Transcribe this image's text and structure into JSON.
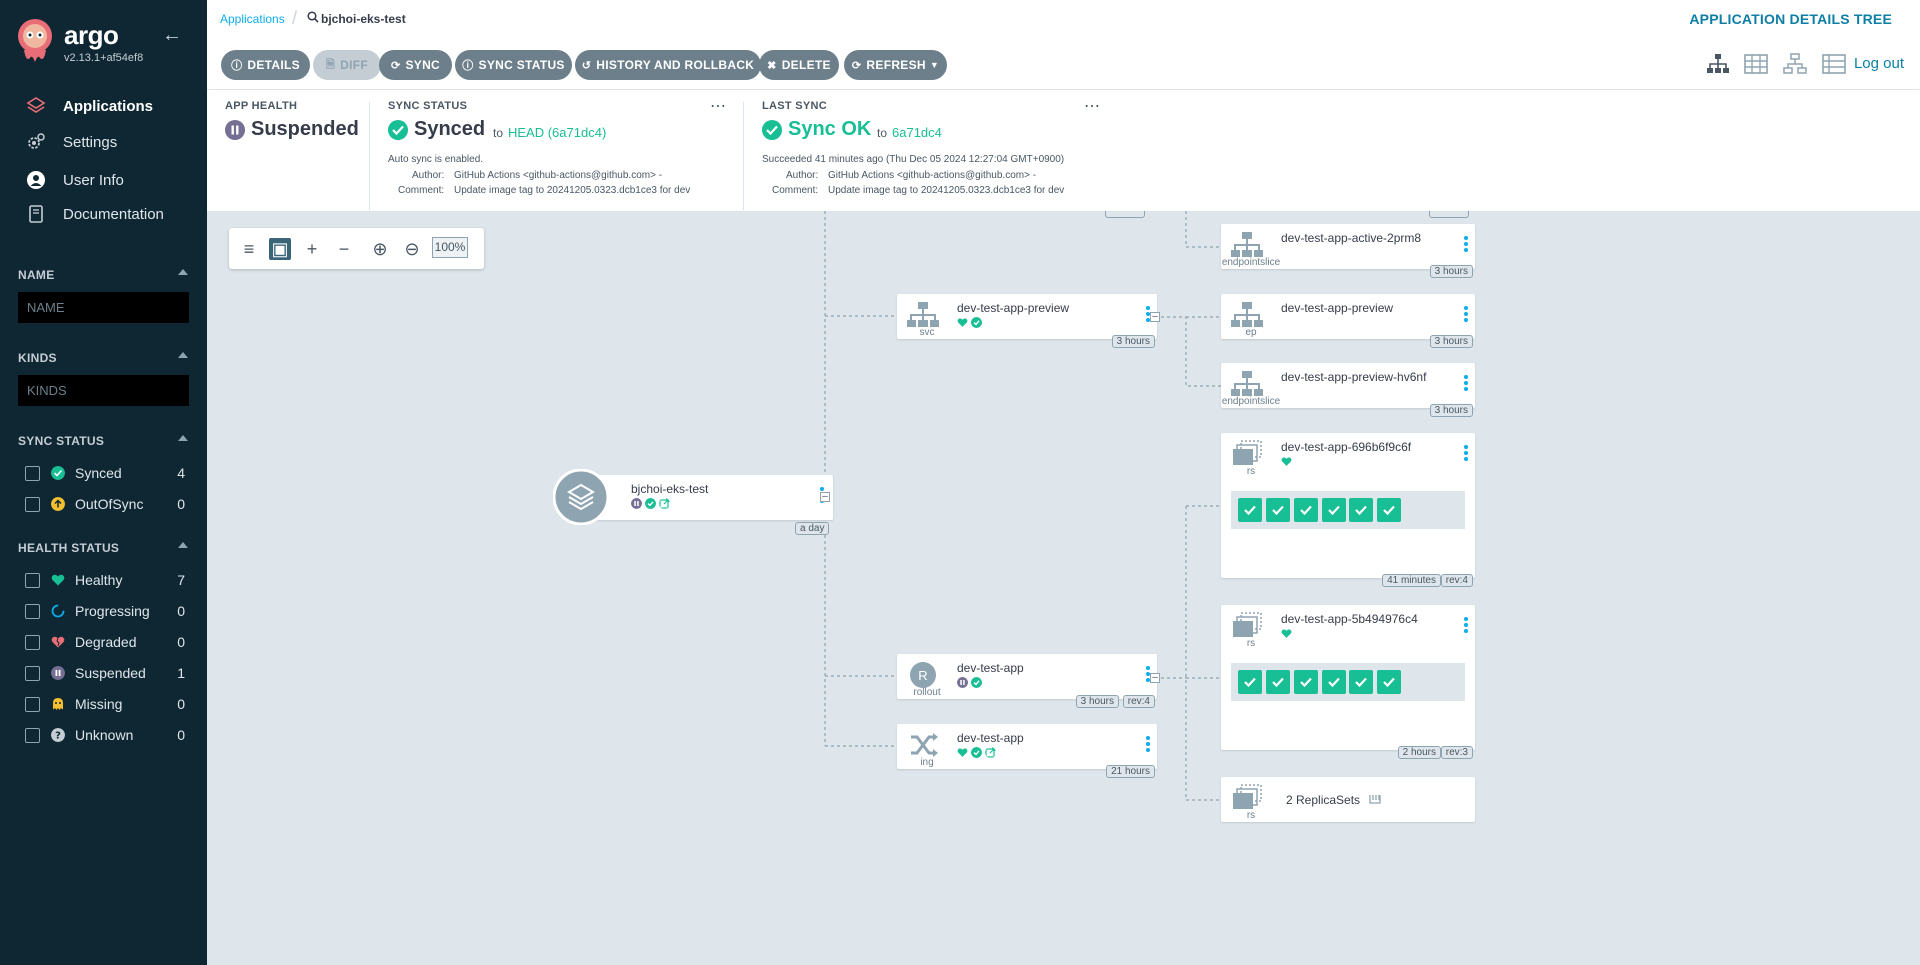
{
  "app": {
    "name": "argo",
    "version": "v2.13.1+af54ef8"
  },
  "sidebar": {
    "nav": [
      {
        "label": "Applications"
      },
      {
        "label": "Settings"
      },
      {
        "label": "User Info"
      },
      {
        "label": "Documentation"
      }
    ],
    "name_filter": {
      "title": "NAME",
      "placeholder": "NAME"
    },
    "kinds_filter": {
      "title": "KINDS",
      "placeholder": "KINDS"
    },
    "sync_status": {
      "title": "SYNC STATUS",
      "items": [
        {
          "label": "Synced",
          "count": "4"
        },
        {
          "label": "OutOfSync",
          "count": "0"
        }
      ]
    },
    "health_status": {
      "title": "HEALTH STATUS",
      "items": [
        {
          "label": "Healthy",
          "count": "7"
        },
        {
          "label": "Progressing",
          "count": "0"
        },
        {
          "label": "Degraded",
          "count": "0"
        },
        {
          "label": "Suspended",
          "count": "1"
        },
        {
          "label": "Missing",
          "count": "0"
        },
        {
          "label": "Unknown",
          "count": "0"
        }
      ]
    }
  },
  "breadcrumb": {
    "root": "Applications",
    "current": "bjchoi-eks-test"
  },
  "page_title": "APPLICATION DETAILS TREE",
  "toolbar": {
    "details": "DETAILS",
    "diff": "DIFF",
    "sync": "SYNC",
    "sync_status": "SYNC STATUS",
    "history": "HISTORY AND ROLLBACK",
    "delete": "DELETE",
    "refresh": "REFRESH",
    "logout": "Log out"
  },
  "status": {
    "app_health": {
      "title": "APP HEALTH",
      "value": "Suspended"
    },
    "sync_status": {
      "title": "SYNC STATUS",
      "value": "Synced",
      "to": "to",
      "target": "HEAD (6a71dc4)",
      "auto": "Auto sync is enabled.",
      "author_label": "Author:",
      "author": "GitHub Actions <github-actions@github.com> -",
      "comment_label": "Comment:",
      "comment": "Update image tag to 20241205.0323.dcb1ce3 for dev"
    },
    "last_sync": {
      "title": "LAST SYNC",
      "value": "Sync OK",
      "to": "to",
      "target": "6a71dc4",
      "succeeded": "Succeeded 41 minutes ago (Thu Dec 05 2024 12:27:04 GMT+0900)",
      "author_label": "Author:",
      "author": "GitHub Actions <github-actions@github.com> -",
      "comment_label": "Comment:",
      "comment": "Update image tag to 20241205.0323.dcb1ce3 for dev"
    }
  },
  "zoom": {
    "level": "100%"
  },
  "nodes": {
    "root": {
      "name": "bjchoi-eks-test",
      "age": "a day"
    },
    "ep_active": {
      "name": "dev-test-app-active-2prm8",
      "kind": "endpointslice",
      "age": "3 hours"
    },
    "svc_preview": {
      "name": "dev-test-app-preview",
      "kind": "svc",
      "age": "3 hours"
    },
    "ep_preview": {
      "name": "dev-test-app-preview",
      "kind": "ep",
      "age": "3 hours"
    },
    "eps_preview": {
      "name": "dev-test-app-preview-hv6nf",
      "kind": "endpointslice",
      "age": "3 hours"
    },
    "rs1": {
      "name": "dev-test-app-696b6f9c6f",
      "kind": "rs",
      "age": "41 minutes",
      "rev": "rev:4"
    },
    "rs2": {
      "name": "dev-test-app-5b494976c4",
      "kind": "rs",
      "age": "2 hours",
      "rev": "rev:3"
    },
    "rollout": {
      "name": "dev-test-app",
      "kind": "rollout",
      "icon_letter": "R",
      "age": "3 hours",
      "rev": "rev:4"
    },
    "ing": {
      "name": "dev-test-app",
      "kind": "ing",
      "age": "21 hours"
    },
    "rs_group": {
      "name": "2 ReplicaSets",
      "kind": "rs"
    }
  },
  "colors": {
    "healthy": "#18be94",
    "suspended": "#766f94",
    "link": "#0dadea",
    "sidebar_bg": "#0f2733"
  }
}
